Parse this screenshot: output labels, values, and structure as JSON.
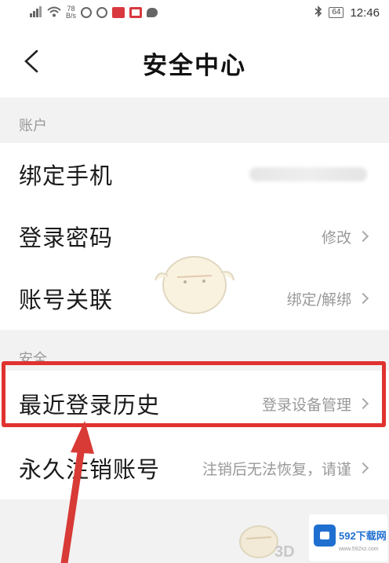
{
  "status_bar": {
    "speed_value": "78",
    "speed_unit": "B/s",
    "battery": "64",
    "time": "12:46"
  },
  "header": {
    "title": "安全中心"
  },
  "sections": {
    "account": {
      "header": "账户",
      "bind_phone_label": "绑定手机",
      "login_password_label": "登录密码",
      "login_password_value": "修改",
      "account_link_label": "账号关联",
      "account_link_value": "绑定/解绑"
    },
    "security": {
      "header": "安全",
      "login_history_label": "最近登录历史",
      "login_history_value": "登录设备管理",
      "delete_account_label": "永久注销账号",
      "delete_account_value": "注销后无法恢复，请谨"
    }
  },
  "watermark": {
    "text_3d": "3D",
    "site_name": "592下载网",
    "site_url": "www.592xz.com"
  },
  "colors": {
    "highlight": "#e0322e",
    "secondary_text": "#999999",
    "background": "#f2f2f2"
  }
}
